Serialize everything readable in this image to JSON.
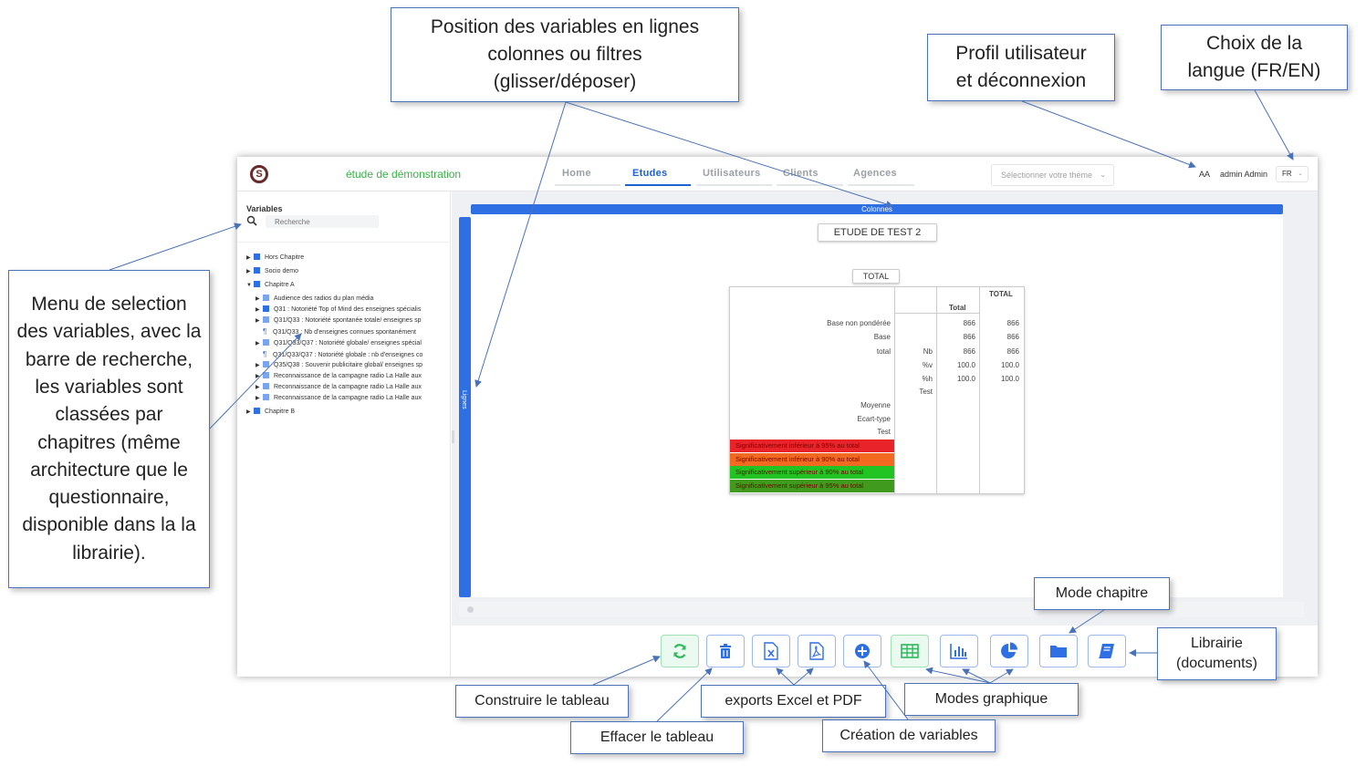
{
  "app": {
    "study_title": "étude de démonstration",
    "nav": [
      "Home",
      "Etudes",
      "Utilisateurs",
      "Clients",
      "Agences"
    ],
    "active_nav": "Etudes",
    "theme_placeholder": "Sélectionner votre thème",
    "font_size_toggle": "AA",
    "user_name": "admin Admin",
    "language": "FR"
  },
  "sidebar": {
    "title": "Variables",
    "search_placeholder": "Recherche",
    "items": [
      {
        "label": "Hors Chapitre",
        "expanded": false
      },
      {
        "label": "Socio demo",
        "expanded": false
      },
      {
        "label": "Chapitre A",
        "expanded": true
      },
      {
        "label": "Audience des radios du plan média"
      },
      {
        "label": "Q31 : Notoriété Top of Mind des enseignes spécialis"
      },
      {
        "label": "Q31/Q33 : Notoriété spontanée totale/ enseignes sp"
      },
      {
        "label": "Q31/Q33 : Nb d'enseignes connues spontanément"
      },
      {
        "label": "Q31/Q33/Q37 : Notoriété globale/ enseignes spécial"
      },
      {
        "label": "Q31/Q33/Q37 : Notoriété globale : nb d'enseignes co"
      },
      {
        "label": "Q35/Q38 : Souvenir publicitaire global/ enseignes sp"
      },
      {
        "label": "Reconnaissance de la campagne radio La Halle aux"
      },
      {
        "label": "Reconnaissance de la campagne radio La Halle aux"
      },
      {
        "label": "Reconnaissance de la campagne radio La Halle aux"
      },
      {
        "label": "Chapitre B",
        "expanded": false
      }
    ]
  },
  "workspace": {
    "columns_label": "Colonnes",
    "rows_label": "Lignes",
    "study_name": "ETUDE DE TEST 2",
    "filter_tag": "TOTAL"
  },
  "table": {
    "header_group": "TOTAL",
    "header_col": "Total",
    "rows": [
      {
        "label": "Base non pondérée",
        "stat": "",
        "total": "866",
        "total2": "866"
      },
      {
        "label": "Base",
        "stat": "",
        "total": "866",
        "total2": "866"
      },
      {
        "label": "total",
        "stat": "Nb",
        "total": "866",
        "total2": "866"
      },
      {
        "label": "",
        "stat": "%v",
        "total": "100.0",
        "total2": "100.0"
      },
      {
        "label": "",
        "stat": "%h",
        "total": "100.0",
        "total2": "100.0"
      },
      {
        "label": "",
        "stat": "Test",
        "total": "",
        "total2": ""
      },
      {
        "label": "Moyenne",
        "stat": "",
        "total": "",
        "total2": ""
      },
      {
        "label": "Ecart-type",
        "stat": "",
        "total": "",
        "total2": ""
      },
      {
        "label": "Test",
        "stat": "",
        "total": "",
        "total2": ""
      }
    ],
    "legend": [
      {
        "label": "Significativement inférieur à 95% au total",
        "color": "#e8242a"
      },
      {
        "label": "Significativement inférieur à 90% au total",
        "color": "#f26a21"
      },
      {
        "label": "Significativement supérieur à 90% au total",
        "color": "#22c424"
      },
      {
        "label": "Significativement supérieur à 95% au total",
        "color": "#3f9a1d"
      }
    ]
  },
  "toolbar": {
    "buttons": [
      "refresh-icon",
      "trash-icon",
      "excel-icon",
      "pdf-icon",
      "plus-circle-icon",
      "grid-table-icon",
      "bar-chart-icon",
      "pie-chart-icon",
      "folder-icon",
      "book-icon"
    ]
  },
  "callouts": {
    "positions": "Position des variables en lignes colonnes ou filtres (glisser/déposer)",
    "profile": "Profil utilisateur et déconnexion",
    "language": "Choix de la langue (FR/EN)",
    "menu": "Menu de selection des variables, avec la barre de recherche, les variables sont classées par chapitres (même architecture que le questionnaire, disponible dans la la librairie).",
    "chapter_mode": "Mode chapitre",
    "library": "Librairie (documents)",
    "build": "Construire le tableau",
    "exports": "exports Excel et PDF",
    "graph_modes": "Modes graphique",
    "erase": "Effacer le tableau",
    "create_vars": "Création de variables"
  },
  "colors": {
    "accent": "#2f6fe4",
    "brand_green": "#3cb04a",
    "callout_border": "#4a72b8"
  }
}
